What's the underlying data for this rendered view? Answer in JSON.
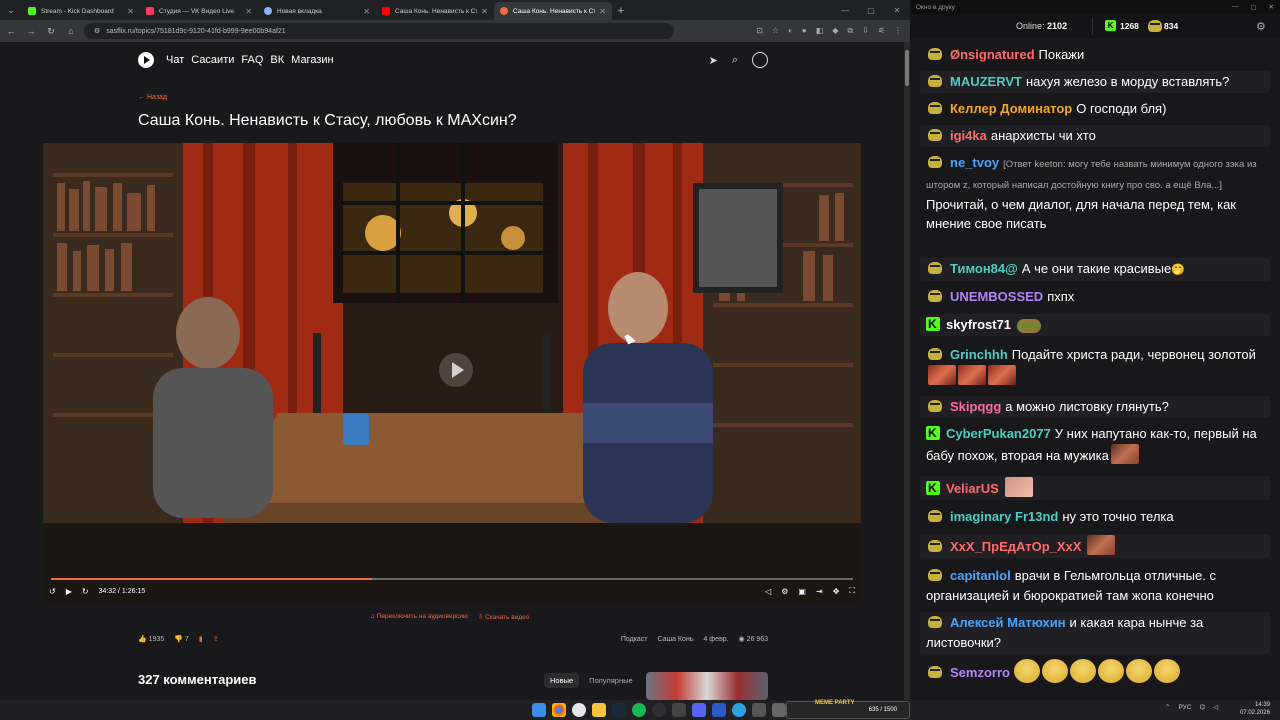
{
  "browser": {
    "tabs": [
      {
        "title": "Stream - Kick Dashboard",
        "color": "#53fc18"
      },
      {
        "title": "Студия — VK Видео Live",
        "color": "#ff3b5c"
      },
      {
        "title": "Новая вкладка",
        "color": "#8ab4f8"
      },
      {
        "title": "Саша Конь. Ненависть к Стасу",
        "color": "#ff0000"
      },
      {
        "title": "Саша Конь. Ненависть к Стасу",
        "color": "#f06a3c"
      }
    ],
    "url": "sasflix.ru/topics/75181d9c-9120-41fd-b999-9ee00b94af21"
  },
  "site": {
    "nav": [
      "Чат",
      "Сасаити",
      "FAQ",
      "ВК",
      "Магазин"
    ],
    "back_label": "← Назад",
    "video_title": "Саша Конь. Ненависть к Стасу, любовь к МАХсин?",
    "player": {
      "time": "34:32 / 1:26:15",
      "progress": 0.4
    },
    "under_player": {
      "audio_link": "Переключить на аудиоверсию",
      "download_link": "Скачать видео"
    },
    "actions": {
      "likes": "1935",
      "dislikes": "7",
      "tag1": "Подкаст",
      "tag2": "Саша Конь",
      "date": "4 февр.",
      "views": "26 963"
    },
    "comments": {
      "title": "327 комментариев",
      "sort_new": "Новые",
      "sort_popular": "Популярные"
    }
  },
  "chat": {
    "window_title": "Окно в друку",
    "online_label": "Online:",
    "online_count": "2102",
    "kick_count": "1268",
    "pepe_count": "834",
    "messages": [
      {
        "badge": "pepe",
        "user": "Ønsignatured",
        "color": "#ff6b6b",
        "text": "Покажи"
      },
      {
        "badge": "pepe",
        "user": "MAUZERVT",
        "color": "#4ecdc4",
        "text": "нахуя железо в морду вставлять?"
      },
      {
        "badge": "pepe",
        "user": "Келлер Доминатор",
        "color": "#f5a623",
        "text": "О господи бля)"
      },
      {
        "badge": "pepe",
        "user": "igi4ka",
        "color": "#ff6b6b",
        "text": "анархисты чи хто"
      },
      {
        "badge": "pepe",
        "user": "ne_tvoy",
        "color": "#4aa3ff",
        "reply": "[Ответ keeton: могу тебе назвать минимум одного зэка из штором z, который написал достойную книгу про сво. а ещё Вла...]",
        "text": "Прочитай, о чем диалог, для начала перед тем, как мнение свое писать"
      },
      {
        "badge": "pepe",
        "user": "Тимон84@",
        "color": "#4ecdc4",
        "text": "А че они такие красивые"
      },
      {
        "badge": "pepe",
        "user": "UNEMBOSSED",
        "color": "#b084f5",
        "text": "пхпх"
      },
      {
        "badge": "kick",
        "user": "skyfrost71",
        "color": "#ffffff",
        "text": ""
      },
      {
        "badge": "pepe",
        "user": "Grinchhh",
        "color": "#4ecdc4",
        "text": "Подайте христа ради, червонец золотой"
      },
      {
        "badge": "pepe",
        "user": "Skipqgg",
        "color": "#ff6b9d",
        "text": "а можно листовку глянуть?"
      },
      {
        "badge": "kick",
        "user": "CyberPukan2077",
        "color": "#4ecdc4",
        "text": "У них напутано как-то, первый на бабу похож, вторая на мужика"
      },
      {
        "badge": "kick",
        "user": "VeliarUS",
        "color": "#ff6b6b",
        "text": ""
      },
      {
        "badge": "pepe",
        "user": "imaginary Fr13nd",
        "color": "#4ecdc4",
        "text": "ну это точно телка"
      },
      {
        "badge": "pepe",
        "user": "XxX_ПрЕдАтОр_XxX",
        "color": "#ff6b6b",
        "text": ""
      },
      {
        "badge": "pepe",
        "user": "capitanlol",
        "color": "#4aa3ff",
        "text": "врачи в Гельмгольца отличные. с организацией и бюрократией там жопа конечно"
      },
      {
        "badge": "pepe",
        "user": "Алексей Матюхин",
        "color": "#4aa3ff",
        "text": "и какая кара нынче за листовочки?"
      },
      {
        "badge": "pepe",
        "user": "Semzorro",
        "color": "#b084f5",
        "text": ""
      }
    ]
  },
  "taskbar": {
    "meme_label": "MEME PARTY",
    "meme_progress": "635 / 1500",
    "lang": "РУС",
    "time": "14:39",
    "date": "07.02.2026"
  }
}
